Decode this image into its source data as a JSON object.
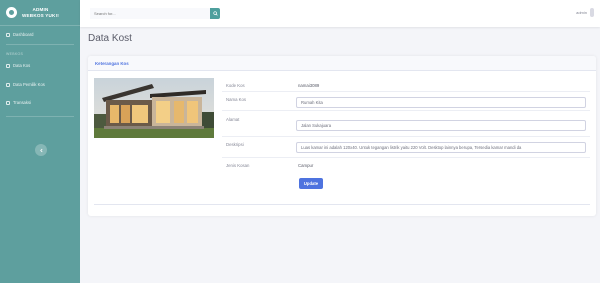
{
  "brand": {
    "line1": "ADMIN",
    "line2": "WEBKOS YUK!!"
  },
  "sidebar": {
    "items": [
      {
        "label": "Dashboard"
      },
      {
        "label": "Data Kos"
      },
      {
        "label": "Data Pemilik Kos"
      },
      {
        "label": "Transaksi"
      }
    ],
    "heading": "WEBKOS",
    "toggle_icon": "chevron-left-icon"
  },
  "topbar": {
    "search_placeholder": "Search for...",
    "user_name": "admin"
  },
  "page": {
    "title": "Data Kost"
  },
  "card": {
    "header": "Keterangan Kos",
    "fields": {
      "kode": {
        "label": "Kode Kos",
        "value": "namai3089"
      },
      "nama": {
        "label": "Nama Kos",
        "value": "Rumah Kita"
      },
      "alamat": {
        "label": "Alamat",
        "value": "Jalan Sukajuara"
      },
      "deskripsi": {
        "label": "Deskripsi",
        "value": "Luas kamar ini adalah 120x40. Untuk tegangan listrik yaitu 220 Volt. Desktop lainnya berupa, Tersedia kamar mandi da"
      },
      "jenis": {
        "label": "Jenis Kosan",
        "value": "Campur"
      }
    },
    "update_label": "Update"
  },
  "colors": {
    "sidebar": "#5e9f9e",
    "primary": "#4e73df",
    "search_button": "#4e9f9d"
  }
}
